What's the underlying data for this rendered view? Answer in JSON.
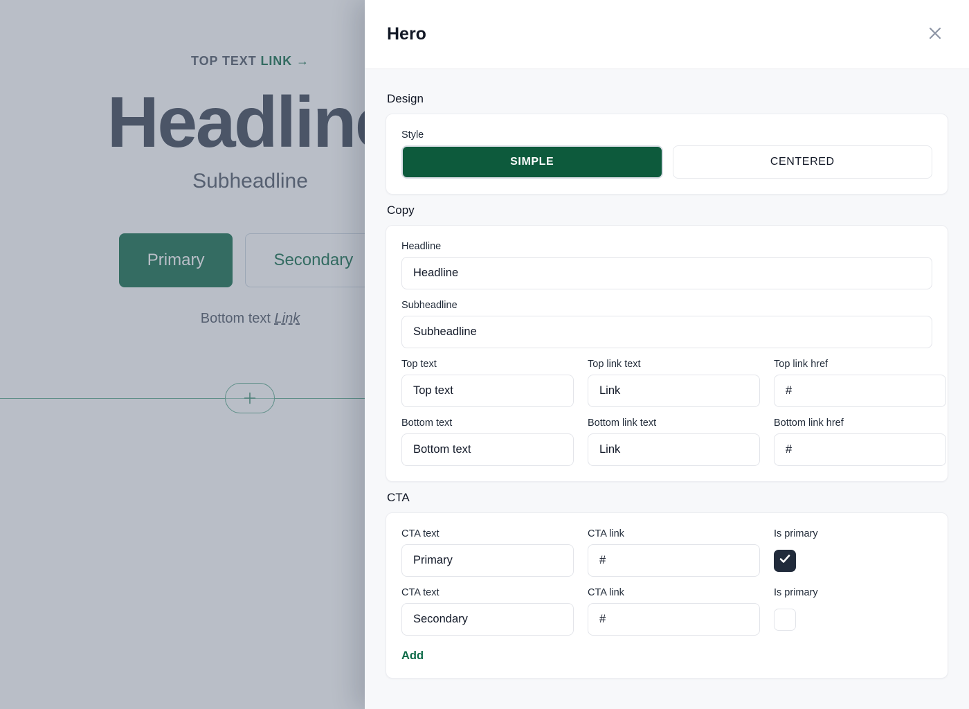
{
  "preview": {
    "top_text": "TOP TEXT",
    "top_link_text": "LINK",
    "top_link_arrow": "→",
    "headline": "Headline",
    "subheadline": "Subheadline",
    "primary_cta": "Primary",
    "secondary_cta": "Secondary",
    "bottom_text": "Bottom text",
    "bottom_link_text": "Link",
    "add_block_icon": "plus-icon"
  },
  "panel": {
    "title": "Hero",
    "close_icon": "close-icon",
    "sections": {
      "design": {
        "title": "Design",
        "style_label": "Style",
        "options": [
          {
            "label": "SIMPLE",
            "selected": true
          },
          {
            "label": "CENTERED",
            "selected": false
          }
        ]
      },
      "copy": {
        "title": "Copy",
        "headline": {
          "label": "Headline",
          "value": "Headline"
        },
        "subheadline": {
          "label": "Subheadline",
          "value": "Subheadline"
        },
        "top_text": {
          "label": "Top text",
          "value": "Top text"
        },
        "top_link_text": {
          "label": "Top link text",
          "value": "Link"
        },
        "top_link_href": {
          "label": "Top link href",
          "value": "#"
        },
        "bottom_text": {
          "label": "Bottom text",
          "value": "Bottom text"
        },
        "bottom_link_text": {
          "label": "Bottom link text",
          "value": "Link"
        },
        "bottom_link_href": {
          "label": "Bottom link href",
          "value": "#"
        }
      },
      "cta": {
        "title": "CTA",
        "col_labels": {
          "text": "CTA text",
          "link": "CTA link",
          "is_primary": "Is primary"
        },
        "rows": [
          {
            "text_label": "CTA text",
            "text": "Primary",
            "link_label": "CTA link",
            "link": "#",
            "primary_label": "Is primary",
            "is_primary": true
          },
          {
            "text_label": "CTA text",
            "text": "Secondary",
            "link_label": "CTA link",
            "link": "#",
            "primary_label": "Is primary",
            "is_primary": false
          }
        ],
        "add_label": "Add"
      }
    }
  },
  "colors": {
    "accent_green": "#0d5a3c",
    "link_green": "#0d6b48",
    "checkbox_checked": "#212b3b",
    "panel_bg": "#f7f8fa",
    "card_bg": "#ffffff",
    "text_dark": "#121826"
  }
}
